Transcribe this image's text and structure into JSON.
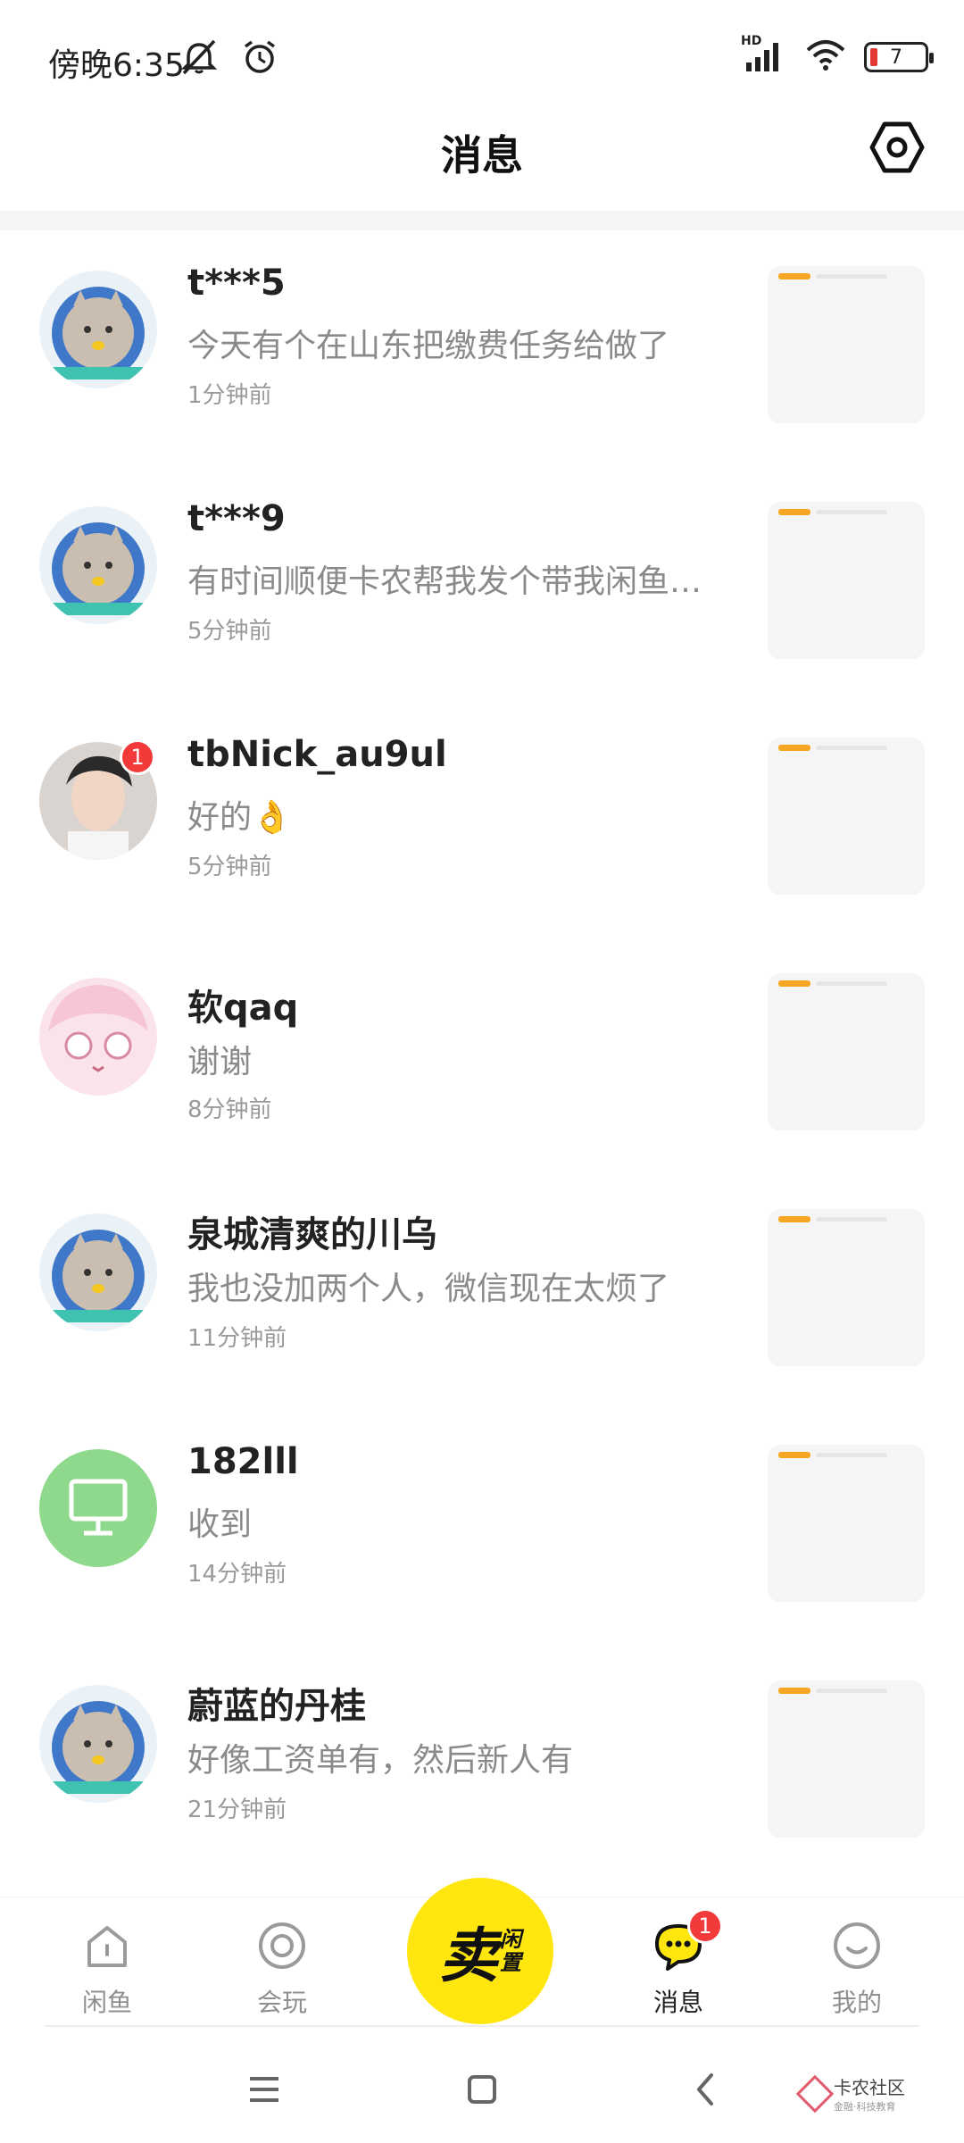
{
  "status_bar": {
    "time": "傍晚6:35",
    "battery": "7",
    "network_label": "HD",
    "icons": [
      "mute-icon",
      "alarm-icon",
      "signal-icon",
      "wifi-icon",
      "battery-icon"
    ]
  },
  "header": {
    "title": "消息",
    "settings_icon": "hexagon-settings-icon"
  },
  "conversations": [
    {
      "name": "t***5",
      "message": "今天有个在山东把缴费任务给做了",
      "time": "1分钟前",
      "avatar": "cat-astronaut-avatar"
    },
    {
      "name": "t***9",
      "message": "有时间顺便卡农帮我发个带我闲鱼…",
      "time": "5分钟前",
      "avatar": "cat-astronaut-avatar"
    },
    {
      "name": "tbNick_au9ul",
      "message": "好的👌",
      "time": "5分钟前",
      "avatar": "photo-avatar",
      "badge": "1"
    },
    {
      "name": "软qaq",
      "message": "谢谢",
      "time": "8分钟前",
      "avatar": "anime-girl-avatar"
    },
    {
      "name": "泉城清爽的川乌",
      "message": "我也没加两个人，微信现在太烦了",
      "time": "11分钟前",
      "avatar": "cat-astronaut-avatar"
    },
    {
      "name": "182lll",
      "message": "收到",
      "time": "14分钟前",
      "avatar": "monitor-avatar"
    },
    {
      "name": "蔚蓝的丹桂",
      "message": "好像工资单有，然后新人有",
      "time": "21分钟前",
      "avatar": "cat-astronaut-avatar"
    }
  ],
  "bottom_nav": {
    "items": [
      {
        "label": "闲鱼",
        "icon": "home-icon"
      },
      {
        "label": "会玩",
        "icon": "circle-target-icon"
      },
      {
        "label": "消息",
        "icon": "chat-bubble-icon",
        "badge": "1",
        "active": true
      },
      {
        "label": "我的",
        "icon": "smile-face-icon"
      }
    ],
    "sell": {
      "big": "卖",
      "small_1": "闲",
      "small_2": "置"
    }
  },
  "watermark": {
    "line1": "卡农社区",
    "line2": "金融·科技教育"
  },
  "colors": {
    "accent_yellow": "#ffe60f",
    "badge_red": "#f23a3a",
    "text_gray": "#8a8a8a"
  }
}
